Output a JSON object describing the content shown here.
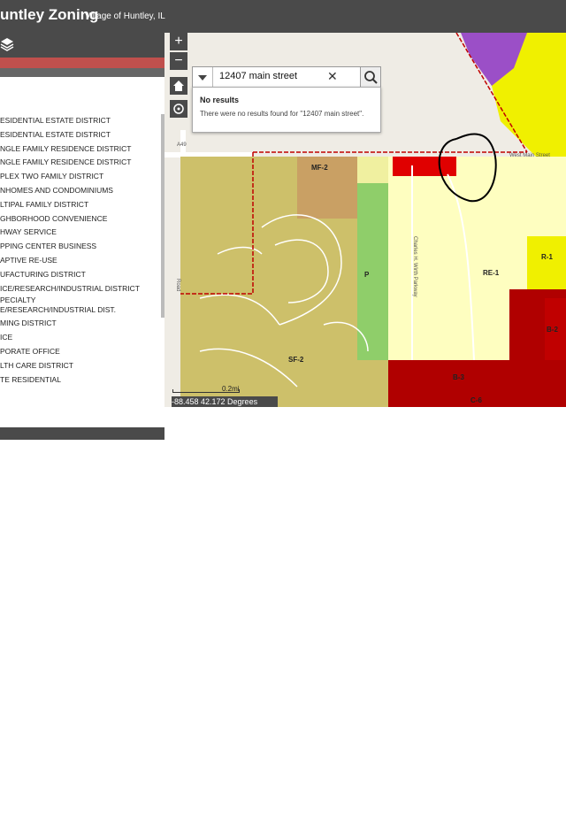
{
  "header": {
    "title": "untley Zoning",
    "subtitle": "Village of Huntley, IL"
  },
  "legend": {
    "items": [
      "ESIDENTIAL ESTATE DISTRICT",
      "ESIDENTIAL ESTATE DISTRICT",
      "NGLE FAMILY RESIDENCE DISTRICT",
      "NGLE FAMILY RESIDENCE DISTRICT",
      "PLEX TWO FAMILY DISTRICT",
      "NHOMES AND CONDOMINIUMS",
      "LTIPAL FAMILY DISTRICT",
      "GHBORHOOD CONVENIENCE",
      "HWAY SERVICE",
      "PPING CENTER BUSINESS",
      "APTIVE RE-USE",
      "UFACTURING DISTRICT",
      "ICE/RESEARCH/INDUSTRIAL DISTRICT",
      "PECIALTY\nE/RESEARCH/INDUSTRIAL DIST.",
      "MING DISTRICT",
      "ICE",
      "PORATE OFFICE",
      "LTH CARE DISTRICT",
      "TE RESIDENTIAL"
    ]
  },
  "search": {
    "value": "12407 main street",
    "no_results_title": "No results",
    "no_results_msg": "There were no results found for \"12407 main street\"."
  },
  "map": {
    "zone_labels": [
      "MF-2",
      "P",
      "SF-2",
      "RE-1",
      "R-1",
      "B-3",
      "B-2",
      "C-6"
    ],
    "road_labels": [
      "A49",
      "Road",
      "Charles H. Wirth Parkway",
      "West Main Street"
    ],
    "scale": "0.2mi",
    "coords": "-88.458 42.172 Degrees"
  },
  "colors": {
    "bar": "#4a4a4a",
    "sf2": "#cdc06a",
    "mf2": "#c9a064",
    "park": "#8fce6a",
    "re1": "#fefec0",
    "b3": "#b00000",
    "bright_red": "#e00000",
    "purple": "#9b4fc7",
    "yellow": "#f0f000"
  }
}
